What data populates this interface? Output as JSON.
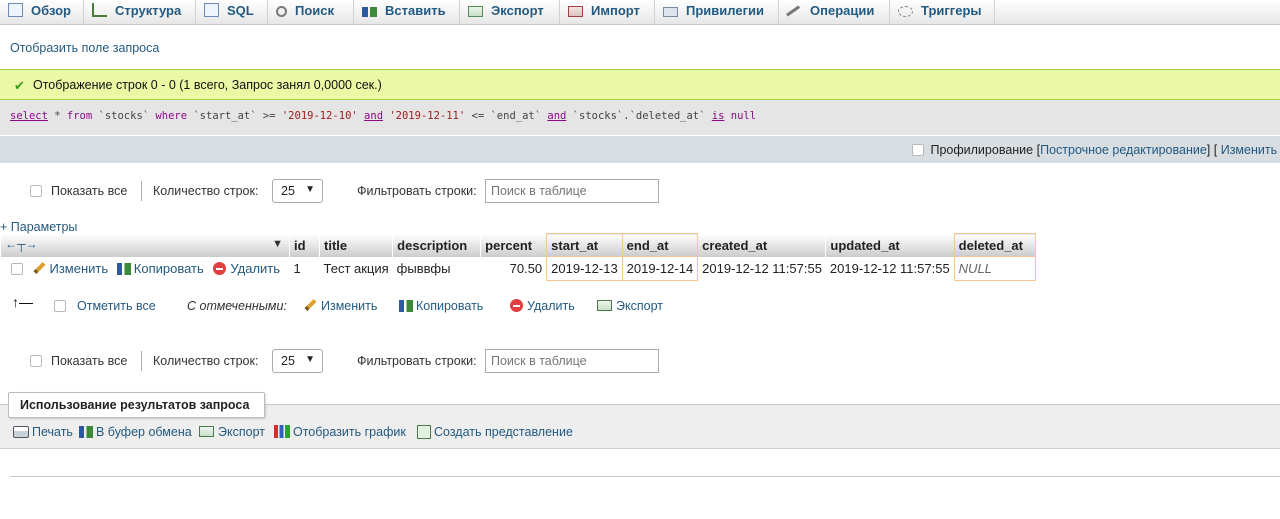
{
  "tabs": [
    {
      "label": "Обзор",
      "icon": "browse-icon"
    },
    {
      "label": "Структура",
      "icon": "structure-icon"
    },
    {
      "label": "SQL",
      "icon": "sql-icon"
    },
    {
      "label": "Поиск",
      "icon": "search-icon"
    },
    {
      "label": "Вставить",
      "icon": "insert-icon"
    },
    {
      "label": "Экспорт",
      "icon": "export-icon"
    },
    {
      "label": "Импорт",
      "icon": "import-icon"
    },
    {
      "label": "Привилегии",
      "icon": "privileges-icon"
    },
    {
      "label": "Операции",
      "icon": "operations-icon"
    },
    {
      "label": "Триггеры",
      "icon": "triggers-icon"
    }
  ],
  "show_query_link": "Отобразить поле запроса",
  "success_message": "Отображение строк 0 - 0 (1 всего, Запрос занял 0,0000 сек.)",
  "sql": {
    "w1": "select",
    "t1": " * ",
    "w2": "from",
    "t2": " `stocks` ",
    "w3": "where",
    "t3": " `start_at` >= ",
    "s1": "'2019-12-10'",
    "t4": " ",
    "w4": "and",
    "t5": " ",
    "s2": "'2019-12-11'",
    "t6": " <= `end_at` ",
    "w5": "and",
    "t7": " `stocks`.`deleted_at` ",
    "w6": "is",
    "t8": " ",
    "w7": "null"
  },
  "profiling": {
    "label": "Профилирование",
    "open": "[",
    "inline_edit": "Построчное редактирование",
    "mid": "] [",
    "edit": "Изменить"
  },
  "nav": {
    "show_all": "Показать все",
    "rows_label": "Количество строк:",
    "rows_value": "25",
    "filter_label": "Фильтровать строки:",
    "filter_placeholder": "Поиск в таблице"
  },
  "options_link": "+ Параметры",
  "table": {
    "columns": [
      "id",
      "title",
      "description",
      "percent",
      "start_at",
      "end_at",
      "created_at",
      "updated_at",
      "deleted_at"
    ],
    "highlighted_columns": [
      "start_at",
      "end_at",
      "deleted_at"
    ],
    "row_actions": {
      "edit": "Изменить",
      "copy": "Копировать",
      "delete": "Удалить"
    },
    "rows": [
      {
        "id": "1",
        "title": "Тест акция",
        "description": "фыввфы",
        "percent": "70.50",
        "start_at": "2019-12-13",
        "end_at": "2019-12-14",
        "created_at": "2019-12-12 11:57:55",
        "updated_at": "2019-12-12 11:57:55",
        "deleted_at": "NULL"
      }
    ]
  },
  "bulk": {
    "check_all": "Отметить все",
    "with_selected": "С отмеченными:",
    "edit": "Изменить",
    "copy": "Копировать",
    "delete": "Удалить",
    "export": "Экспорт"
  },
  "results": {
    "title": "Использование результатов запроса",
    "print": "Печать",
    "clipboard": "В буфер обмена",
    "export": "Экспорт",
    "chart": "Отобразить график",
    "create_view": "Создать представление"
  },
  "colors": {
    "link": "#235a81",
    "success_bg": "#ebf8a4",
    "highlight_border": "#f6c890",
    "tab_bar": "#e6e6e6"
  }
}
